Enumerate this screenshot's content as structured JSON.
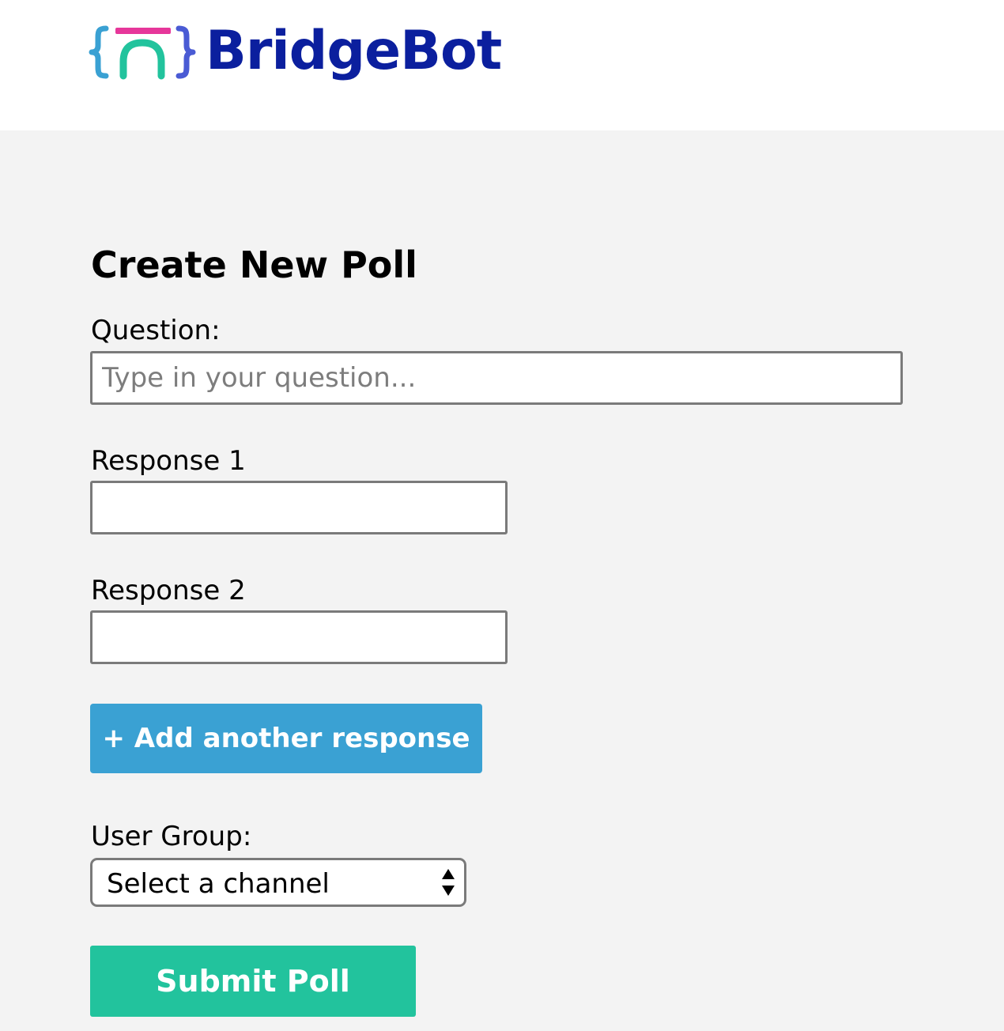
{
  "brand": {
    "name": "BridgeBot",
    "text_color": "#0b1f9e",
    "logo_colors": {
      "left_brace": "#3aa1d3",
      "top_bar": "#e6379a",
      "arch": "#22c39d",
      "right_brace": "#4a5bd4"
    }
  },
  "form": {
    "title": "Create New Poll",
    "question": {
      "label": "Question:",
      "placeholder": "Type in your question...",
      "value": ""
    },
    "responses": [
      {
        "label": "Response 1",
        "value": ""
      },
      {
        "label": "Response 2",
        "value": ""
      }
    ],
    "add_response_label": "+ Add another response",
    "user_group": {
      "label": "User Group:",
      "selected": "Select a channel",
      "icon": "updown-arrows-icon"
    },
    "submit_label": "Submit Poll"
  },
  "colors": {
    "page_background": "#f3f3f3",
    "header_background": "#ffffff",
    "add_button": "#3aa1d3",
    "submit_button": "#22c39d",
    "input_border": "#7a7a7a"
  }
}
